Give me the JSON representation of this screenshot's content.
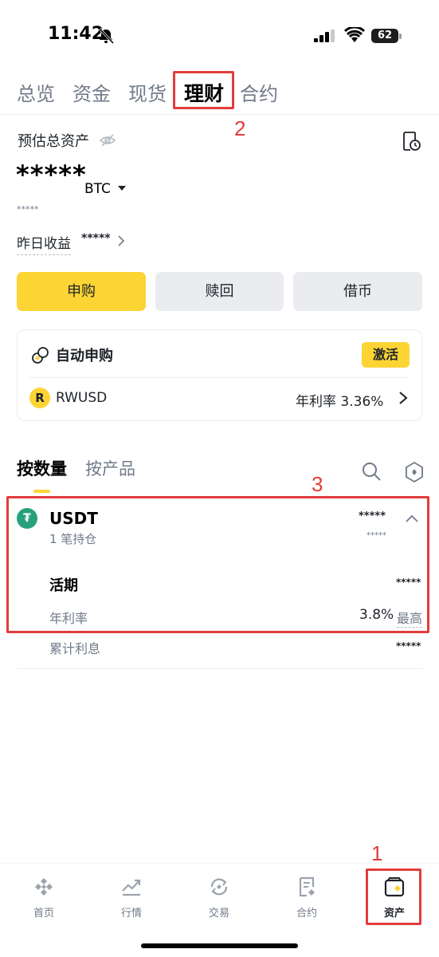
{
  "status_bar": {
    "time": "11:42",
    "battery": "62"
  },
  "tabs": [
    {
      "label": "总览"
    },
    {
      "label": "资金"
    },
    {
      "label": "现货"
    },
    {
      "label": "理财"
    },
    {
      "label": "合约"
    }
  ],
  "overview": {
    "estimated_label": "预估总资产",
    "balance_mask": "*****",
    "currency": "BTC",
    "sub_mask": "*****",
    "yesterday_label": "昨日收益",
    "yesterday_value": "*****"
  },
  "actions": {
    "subscribe": "申购",
    "redeem": "赎回",
    "borrow": "借币"
  },
  "auto_subscribe": {
    "title": "自动申购",
    "activate": "激活",
    "asset": "RWUSD",
    "apr_text": "年利率 3.36%"
  },
  "subtabs": [
    {
      "label": "按数量"
    },
    {
      "label": "按产品"
    }
  ],
  "holding": {
    "symbol": "USDT",
    "positions": "1 笔持仓",
    "amount_mask": "*****",
    "amount_sub_mask": "*****",
    "flexible_label": "活期",
    "flexible_mask": "*****",
    "apr_label": "年利率",
    "apr_value": "3.8%",
    "apr_high": "最高",
    "interest_label": "累计利息",
    "interest_mask": "*****"
  },
  "annotations": {
    "n1": "1",
    "n2": "2",
    "n3": "3"
  },
  "bottom_nav": [
    {
      "label": "首页",
      "icon": "home-icon"
    },
    {
      "label": "行情",
      "icon": "markets-icon"
    },
    {
      "label": "交易",
      "icon": "trade-icon"
    },
    {
      "label": "合约",
      "icon": "futures-icon"
    },
    {
      "label": "资产",
      "icon": "wallet-icon"
    }
  ],
  "colors": {
    "accent": "#fcd535",
    "annotation": "#e23c3c",
    "usdt": "#26a17b"
  }
}
